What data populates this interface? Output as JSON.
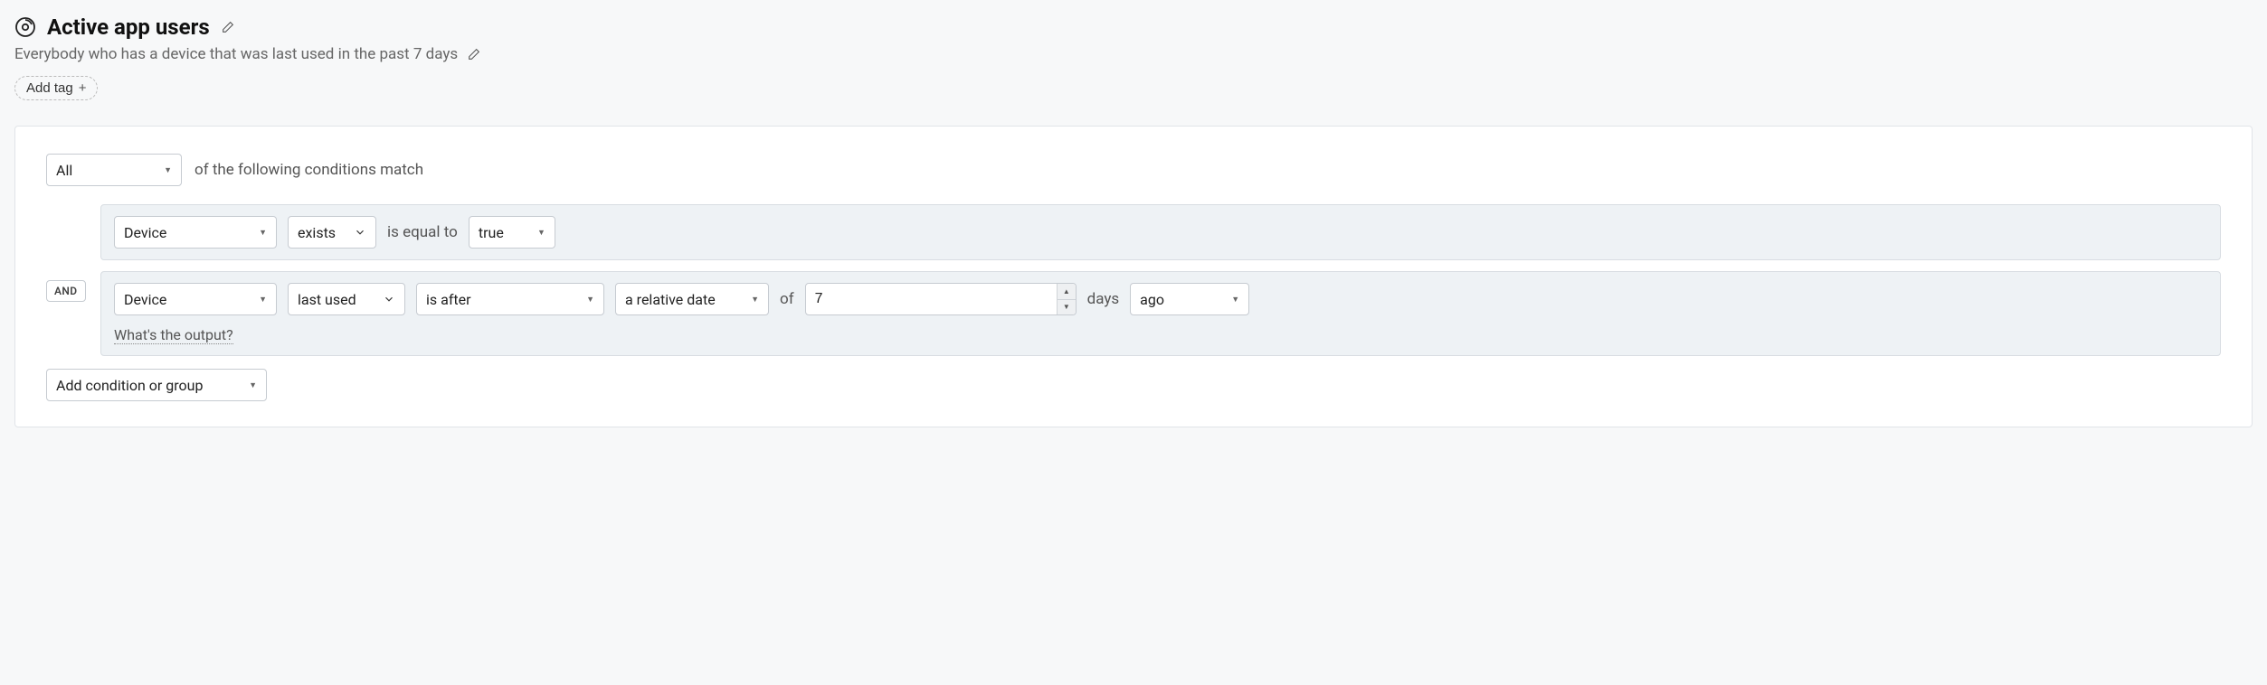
{
  "header": {
    "title": "Active app users",
    "description": "Everybody who has a device that was last used in the past 7 days",
    "add_tag_label": "Add tag"
  },
  "builder": {
    "match_mode": "All",
    "match_suffix": "of the following conditions match",
    "join_label": "AND",
    "add_condition_label": "Add condition or group",
    "output_link": "What's the output?",
    "conditions": [
      {
        "field": "Device",
        "operator": "exists",
        "mid_text": "is equal to",
        "value": "true"
      },
      {
        "field": "Device",
        "operator": "last used",
        "comparator": "is after",
        "date_type": "a relative date",
        "of_label": "of",
        "number": "7",
        "unit": "days",
        "direction": "ago"
      }
    ]
  }
}
